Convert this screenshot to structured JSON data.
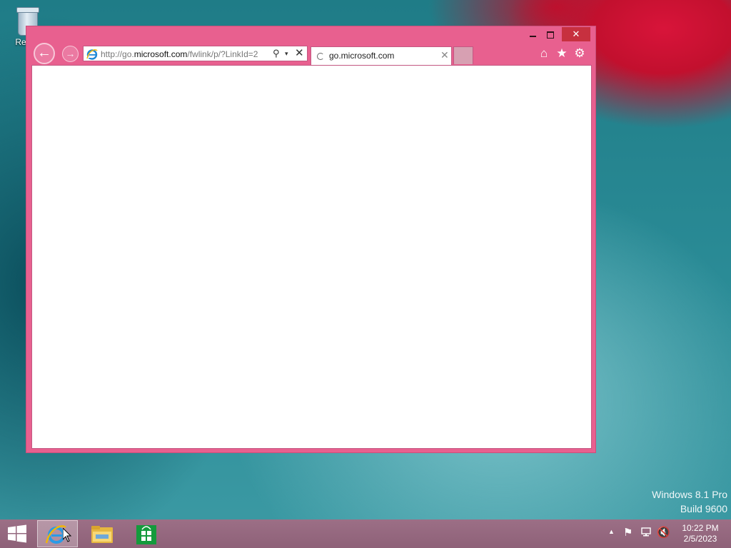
{
  "desktop": {
    "recycle_bin_label": "Recyc"
  },
  "browser": {
    "address_prefix": "http://go.",
    "address_domain": "microsoft.com",
    "address_suffix": "/fwlink/p/?LinkId=2",
    "tab_title": "go.microsoft.com",
    "close_glyph": "✕",
    "tab_close_glyph": "✕",
    "back_glyph": "←",
    "forward_glyph": "→",
    "search_glyph": "⚲",
    "dropdown_glyph": "▾",
    "stop_glyph": "✕",
    "home_glyph": "⌂",
    "favorites_glyph": "★",
    "tools_glyph": "⚙",
    "frame_color": "#e8608f"
  },
  "watermark": {
    "line1": "Windows 8.1 Pro",
    "line2": "Build 9600"
  },
  "taskbar": {
    "apps": [
      "internet-explorer",
      "file-explorer",
      "store"
    ],
    "tray_up_glyph": "▲",
    "flag_glyph": "⚑",
    "volume_glyph": "🔇",
    "time": "10:22 PM",
    "date": "2/5/2023"
  }
}
